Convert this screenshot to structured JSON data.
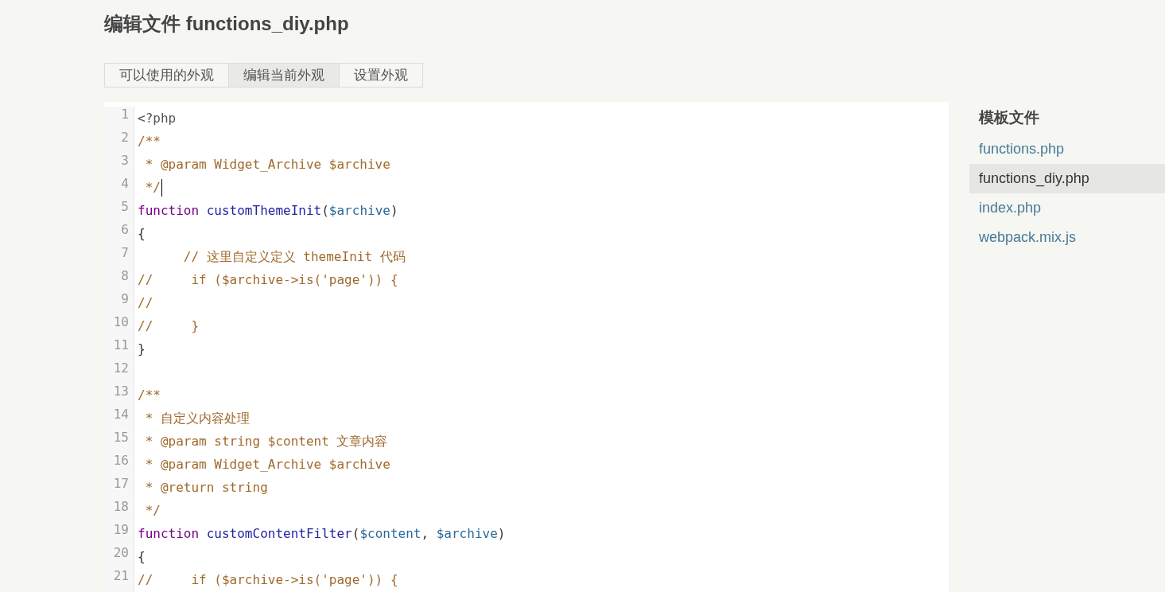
{
  "page_title": "编辑文件 functions_diy.php",
  "tabs": [
    {
      "label": "可以使用的外观",
      "selected": false
    },
    {
      "label": "编辑当前外观",
      "selected": true
    },
    {
      "label": "设置外观",
      "selected": false
    }
  ],
  "editor": {
    "lines": [
      {
        "number": "1",
        "cursor": false,
        "tokens": [
          {
            "kind": "meta",
            "text": "<?php"
          }
        ]
      },
      {
        "number": "2",
        "cursor": false,
        "tokens": [
          {
            "kind": "comment",
            "text": "/**"
          }
        ]
      },
      {
        "number": "3",
        "cursor": false,
        "tokens": [
          {
            "kind": "comment",
            "text": " * @param Widget_Archive $archive"
          }
        ]
      },
      {
        "number": "4",
        "cursor": true,
        "tokens": [
          {
            "kind": "comment",
            "text": " */"
          }
        ]
      },
      {
        "number": "5",
        "cursor": false,
        "tokens": [
          {
            "kind": "keyword",
            "text": "function "
          },
          {
            "kind": "def",
            "text": "customThemeInit"
          },
          {
            "kind": "plain",
            "text": "("
          },
          {
            "kind": "variable",
            "text": "$archive"
          },
          {
            "kind": "plain",
            "text": ")"
          }
        ]
      },
      {
        "number": "6",
        "cursor": false,
        "tokens": [
          {
            "kind": "plain",
            "text": "{"
          }
        ]
      },
      {
        "number": "7",
        "cursor": false,
        "tokens": [
          {
            "kind": "comment",
            "text": "      // 这里自定义定义 themeInit 代码"
          }
        ]
      },
      {
        "number": "8",
        "cursor": false,
        "tokens": [
          {
            "kind": "comment",
            "text": "//     if ($archive->is('page')) {"
          }
        ]
      },
      {
        "number": "9",
        "cursor": false,
        "tokens": [
          {
            "kind": "comment",
            "text": "//"
          }
        ]
      },
      {
        "number": "10",
        "cursor": false,
        "tokens": [
          {
            "kind": "comment",
            "text": "//     }"
          }
        ]
      },
      {
        "number": "11",
        "cursor": false,
        "tokens": [
          {
            "kind": "plain",
            "text": "}"
          }
        ]
      },
      {
        "number": "12",
        "cursor": false
      },
      {
        "number": "13",
        "cursor": false,
        "tokens": [
          {
            "kind": "comment",
            "text": "/**"
          }
        ]
      },
      {
        "number": "14",
        "cursor": false,
        "tokens": [
          {
            "kind": "comment",
            "text": " * 自定义内容处理"
          }
        ]
      },
      {
        "number": "15",
        "cursor": false,
        "tokens": [
          {
            "kind": "comment",
            "text": " * @param string $content 文章内容"
          }
        ]
      },
      {
        "number": "16",
        "cursor": false,
        "tokens": [
          {
            "kind": "comment",
            "text": " * @param Widget_Archive $archive"
          }
        ]
      },
      {
        "number": "17",
        "cursor": false,
        "tokens": [
          {
            "kind": "comment",
            "text": " * @return string"
          }
        ]
      },
      {
        "number": "18",
        "cursor": false,
        "tokens": [
          {
            "kind": "comment",
            "text": " */"
          }
        ]
      },
      {
        "number": "19",
        "cursor": false,
        "tokens": [
          {
            "kind": "keyword",
            "text": "function "
          },
          {
            "kind": "def",
            "text": "customContentFilter"
          },
          {
            "kind": "plain",
            "text": "("
          },
          {
            "kind": "variable",
            "text": "$content"
          },
          {
            "kind": "plain",
            "text": ","
          },
          {
            "kind": "variable",
            "text": " $archive"
          },
          {
            "kind": "plain",
            "text": ")"
          }
        ]
      },
      {
        "number": "20",
        "cursor": false,
        "tokens": [
          {
            "kind": "plain",
            "text": "{"
          }
        ]
      },
      {
        "number": "21",
        "cursor": false,
        "tokens": [
          {
            "kind": "comment",
            "text": "//     if ($archive->is('page')) {"
          }
        ]
      }
    ]
  },
  "sidebar": {
    "heading": "模板文件",
    "files": [
      {
        "label": "functions.php",
        "selected": false
      },
      {
        "label": "functions_diy.php",
        "selected": true
      },
      {
        "label": "index.php",
        "selected": false
      },
      {
        "label": "webpack.mix.js",
        "selected": false
      }
    ]
  }
}
